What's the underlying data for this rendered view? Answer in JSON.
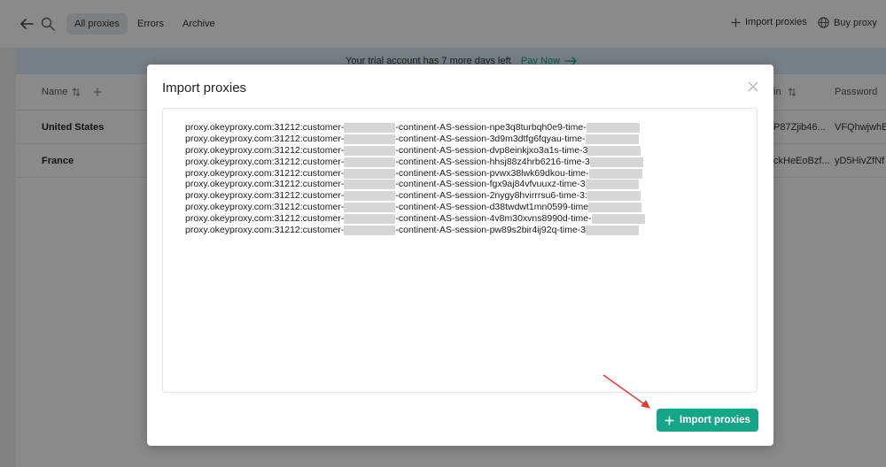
{
  "topbar": {
    "tabs": [
      {
        "label": "All proxies"
      },
      {
        "label": "Errors"
      },
      {
        "label": "Archive"
      }
    ],
    "import_label": "Import proxies",
    "buy_label": "Buy proxy"
  },
  "banner": {
    "message": "Your trial account has 7 more days left",
    "pay_label": "Pay Now"
  },
  "table": {
    "headers": {
      "name": "Name",
      "login_partial": "in",
      "password": "Password"
    },
    "rows": [
      {
        "name": "United States",
        "login": "P87Zjib46...",
        "password": "VFQhwjwhB"
      },
      {
        "name": "France",
        "login": "ckHeEoBzf...",
        "password": "yD5HivZfNf"
      }
    ]
  },
  "modal": {
    "title": "Import proxies",
    "button_label": "Import proxies",
    "lines": [
      {
        "prefix": "proxy.okeyproxy.com:31212:customer-",
        "middle": "-continent-AS-session-npe3q8turbqh0e9-time-"
      },
      {
        "prefix": "proxy.okeyproxy.com:31212:customer-",
        "middle": "-continent-AS-session-3d9m3dtfg6fqyau-time-"
      },
      {
        "prefix": "proxy.okeyproxy.com:31212:customer-",
        "middle": "-continent-AS-session-dvp8einkjxo3a1s-time-3"
      },
      {
        "prefix": "proxy.okeyproxy.com:31212:customer-",
        "middle": "-continent-AS-session-hhsj88z4hrb6216-time-3"
      },
      {
        "prefix": "proxy.okeyproxy.com:31212:customer-",
        "middle": "-continent-AS-session-pvwx38lwk69dkou-time-"
      },
      {
        "prefix": "proxy.okeyproxy.com:31212:customer-",
        "middle": "-continent-AS-session-fgx9aj84vfvuuxz-time-3"
      },
      {
        "prefix": "proxy.okeyproxy.com:31212:customer-",
        "middle": "-continent-AS-session-2nygy8hvirrrsu6-time-3:"
      },
      {
        "prefix": "proxy.okeyproxy.com:31212:customer-",
        "middle": "-continent-AS-session-d38twdwt1mn0599-time"
      },
      {
        "prefix": "proxy.okeyproxy.com:31212:customer-",
        "middle": "-continent-AS-session-4v8m30xvns8990d-time-"
      },
      {
        "prefix": "proxy.okeyproxy.com:31212:customer-",
        "middle": "-continent-AS-session-pw89s2bir4ij92q-time-3"
      }
    ]
  },
  "colors": {
    "accent": "#17a589",
    "banner": "#dcecf8",
    "annotation_arrow": "#e53935"
  },
  "icons": [
    "back-arrow-icon",
    "search-icon",
    "plus-icon",
    "globe-icon",
    "arrow-right-icon",
    "sort-icon",
    "close-icon"
  ]
}
